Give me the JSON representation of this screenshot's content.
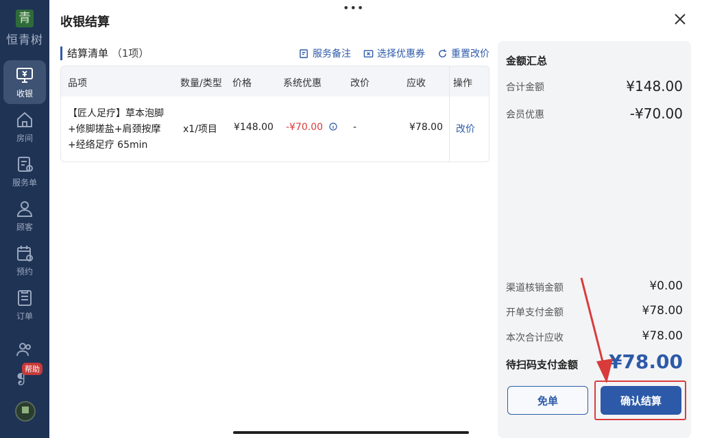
{
  "sidebar": {
    "logo_glyph": "青",
    "logo_text": "恒青树",
    "items": [
      {
        "label": "收银",
        "icon": "cashier-monitor-icon"
      },
      {
        "label": "房间",
        "icon": "room-house-icon"
      },
      {
        "label": "服务单",
        "icon": "service-order-icon"
      },
      {
        "label": "顾客",
        "icon": "customer-person-icon"
      },
      {
        "label": "预约",
        "icon": "calendar-icon"
      },
      {
        "label": "订单",
        "icon": "order-list-icon"
      }
    ],
    "help_badge": "帮助"
  },
  "header": {
    "title": "收银结算",
    "more": "•••"
  },
  "list": {
    "title": "结算清单",
    "count": "（1项）",
    "actions": {
      "note": "服务备注",
      "coupon": "选择优惠券",
      "reset": "重置改价"
    }
  },
  "table": {
    "columns": {
      "item": "品项",
      "qty": "数量/类型",
      "price": "价格",
      "discount": "系统优惠",
      "adjust": "改价",
      "due": "应收",
      "op": "操作"
    },
    "rows": [
      {
        "item_lines": [
          "【匠人足疗】草本泡脚",
          "+修脚搓盐+肩颈按摩",
          "+经络足疗 65min"
        ],
        "qty": "x1/项目",
        "price": "¥148.00",
        "discount": "-¥70.00",
        "adjust": "-",
        "due": "¥78.00",
        "op": "改价"
      }
    ]
  },
  "summary": {
    "title": "金额汇总",
    "total_label": "合计金额",
    "total_value": "¥148.00",
    "member_label": "会员优惠",
    "member_value": "-¥70.00",
    "channel_label": "渠道核销金额",
    "channel_value": "¥0.00",
    "open_label": "开单支付金额",
    "open_value": "¥78.00",
    "due_label": "本次合计应收",
    "due_value": "¥78.00",
    "scan_label": "待扫码支付金额",
    "scan_value": "¥78.00"
  },
  "buttons": {
    "free": "免单",
    "confirm": "确认结算"
  },
  "colors": {
    "sidebar": "#1f3355",
    "accent": "#2d5aa8",
    "discount_red": "#d93b3b",
    "annotation_red": "#d93b3b"
  }
}
